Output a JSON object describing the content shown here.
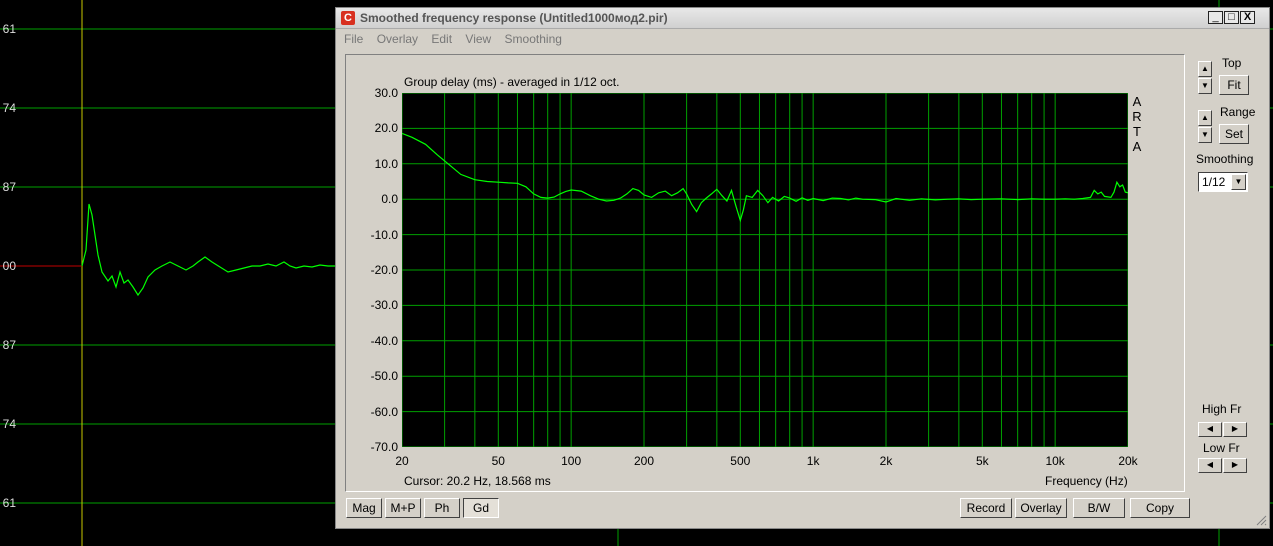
{
  "background_plot": {
    "ticks": [
      "61",
      "74",
      "87",
      "00",
      "87",
      "74",
      "61"
    ]
  },
  "window": {
    "title": "Smoothed frequency response (Untitled1000мод2.pir)",
    "icon": "arta-app-icon",
    "controls": {
      "minimize": "_",
      "maximize": "□",
      "close": "X"
    },
    "menu": [
      "File",
      "Overlay",
      "Edit",
      "View",
      "Smoothing"
    ]
  },
  "chart_data": {
    "type": "line",
    "title": "Group delay (ms) - averaged in 1/12 oct.",
    "xlabel": "Frequency (Hz)",
    "ylabel": "Group delay (ms)",
    "x_scale": "log",
    "xlim": [
      20,
      20000
    ],
    "ylim": [
      -70,
      30
    ],
    "y_ticks": [
      "30.0",
      "20.0",
      "10.0",
      "0.0",
      "-10.0",
      "-20.0",
      "-30.0",
      "-40.0",
      "-50.0",
      "-60.0",
      "-70.0"
    ],
    "x_ticks": [
      {
        "value": 20,
        "label": "20"
      },
      {
        "value": 50,
        "label": "50"
      },
      {
        "value": 100,
        "label": "100"
      },
      {
        "value": 200,
        "label": "200"
      },
      {
        "value": 500,
        "label": "500"
      },
      {
        "value": 1000,
        "label": "1k"
      },
      {
        "value": 2000,
        "label": "2k"
      },
      {
        "value": 5000,
        "label": "5k"
      },
      {
        "value": 10000,
        "label": "10k"
      },
      {
        "value": 20000,
        "label": "20k"
      }
    ],
    "watermark": [
      "A",
      "R",
      "T",
      "A"
    ],
    "grid": true,
    "series": [
      {
        "color": "#00ff00",
        "points": [
          [
            20,
            18.6
          ],
          [
            22,
            17.5
          ],
          [
            25,
            15.5
          ],
          [
            28,
            12.5
          ],
          [
            31,
            10.0
          ],
          [
            35,
            7.0
          ],
          [
            40,
            5.5
          ],
          [
            45,
            5.0
          ],
          [
            50,
            4.8
          ],
          [
            55,
            4.6
          ],
          [
            60,
            4.5
          ],
          [
            65,
            3.5
          ],
          [
            70,
            1.5
          ],
          [
            75,
            0.5
          ],
          [
            80,
            0.3
          ],
          [
            85,
            0.6
          ],
          [
            90,
            1.5
          ],
          [
            95,
            2.2
          ],
          [
            100,
            2.6
          ],
          [
            110,
            2.3
          ],
          [
            120,
            1.0
          ],
          [
            130,
            0.0
          ],
          [
            140,
            -0.5
          ],
          [
            150,
            -0.3
          ],
          [
            160,
            0.3
          ],
          [
            170,
            1.5
          ],
          [
            180,
            3.0
          ],
          [
            190,
            2.5
          ],
          [
            200,
            1.2
          ],
          [
            215,
            0.5
          ],
          [
            230,
            1.8
          ],
          [
            245,
            2.3
          ],
          [
            260,
            1.0
          ],
          [
            275,
            1.8
          ],
          [
            290,
            3.0
          ],
          [
            300,
            1.5
          ],
          [
            315,
            -1.5
          ],
          [
            330,
            -3.5
          ],
          [
            345,
            -1.0
          ],
          [
            360,
            0.2
          ],
          [
            380,
            1.5
          ],
          [
            400,
            2.8
          ],
          [
            420,
            1.0
          ],
          [
            440,
            -0.5
          ],
          [
            460,
            2.5
          ],
          [
            480,
            -2.0
          ],
          [
            500,
            -6.0
          ],
          [
            515,
            -3.0
          ],
          [
            530,
            1.0
          ],
          [
            560,
            0.5
          ],
          [
            590,
            2.5
          ],
          [
            620,
            1.0
          ],
          [
            650,
            -1.0
          ],
          [
            680,
            0.5
          ],
          [
            720,
            -0.5
          ],
          [
            760,
            0.8
          ],
          [
            800,
            0.3
          ],
          [
            850,
            -0.6
          ],
          [
            900,
            0.4
          ],
          [
            950,
            -0.3
          ],
          [
            1000,
            0.2
          ],
          [
            1100,
            -0.4
          ],
          [
            1200,
            0.3
          ],
          [
            1300,
            0.2
          ],
          [
            1400,
            -0.2
          ],
          [
            1500,
            0.3
          ],
          [
            1600,
            0.0
          ],
          [
            1800,
            -0.1
          ],
          [
            2000,
            -0.8
          ],
          [
            2200,
            0.2
          ],
          [
            2500,
            -0.3
          ],
          [
            2800,
            0.1
          ],
          [
            3200,
            -0.2
          ],
          [
            3600,
            0.0
          ],
          [
            4000,
            0.1
          ],
          [
            4500,
            -0.1
          ],
          [
            5000,
            0.0
          ],
          [
            6000,
            0.1
          ],
          [
            7000,
            -0.1
          ],
          [
            8000,
            0.1
          ],
          [
            9000,
            0.0
          ],
          [
            10000,
            0.0
          ],
          [
            11000,
            0.1
          ],
          [
            12000,
            0.0
          ],
          [
            13000,
            0.2
          ],
          [
            14000,
            0.5
          ],
          [
            14500,
            2.5
          ],
          [
            15000,
            1.5
          ],
          [
            15500,
            2.0
          ],
          [
            16000,
            0.8
          ],
          [
            17000,
            0.5
          ],
          [
            17500,
            2.0
          ],
          [
            18000,
            4.8
          ],
          [
            18500,
            3.5
          ],
          [
            19000,
            4.0
          ],
          [
            19500,
            2.0
          ],
          [
            20000,
            1.8
          ]
        ]
      }
    ]
  },
  "status": {
    "cursor": "Cursor: 20.2 Hz, 18.568 ms"
  },
  "side_panel": {
    "top_label": "Top",
    "fit_label": "Fit",
    "range_label": "Range",
    "set_label": "Set",
    "smoothing_label": "Smoothing",
    "smoothing_value": "1/12",
    "high_fr_label": "High Fr",
    "low_fr_label": "Low Fr"
  },
  "bottom_buttons": {
    "mag": "Mag",
    "mp": "M+P",
    "ph": "Ph",
    "gd": "Gd",
    "record": "Record",
    "overlay": "Overlay",
    "bw": "B/W",
    "copy": "Copy"
  }
}
